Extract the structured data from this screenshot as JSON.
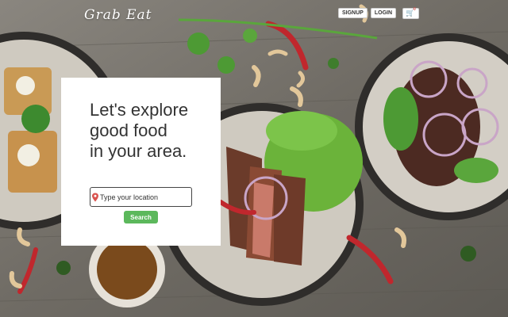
{
  "brand": {
    "logo_text": "Grab Eat"
  },
  "header": {
    "signup_label": "SIGNUP",
    "login_label": "LOGIN",
    "cart_count": "0"
  },
  "hero": {
    "heading_lines": [
      "Let's explore",
      "good food",
      "in your area."
    ],
    "location_placeholder": "Type your location",
    "search_label": "Search"
  },
  "colors": {
    "search_button": "#5cb85c",
    "location_pin": "#d9534f",
    "card_bg": "#ffffff"
  },
  "icons": [
    "location-pin-icon",
    "shopping-cart-icon"
  ]
}
